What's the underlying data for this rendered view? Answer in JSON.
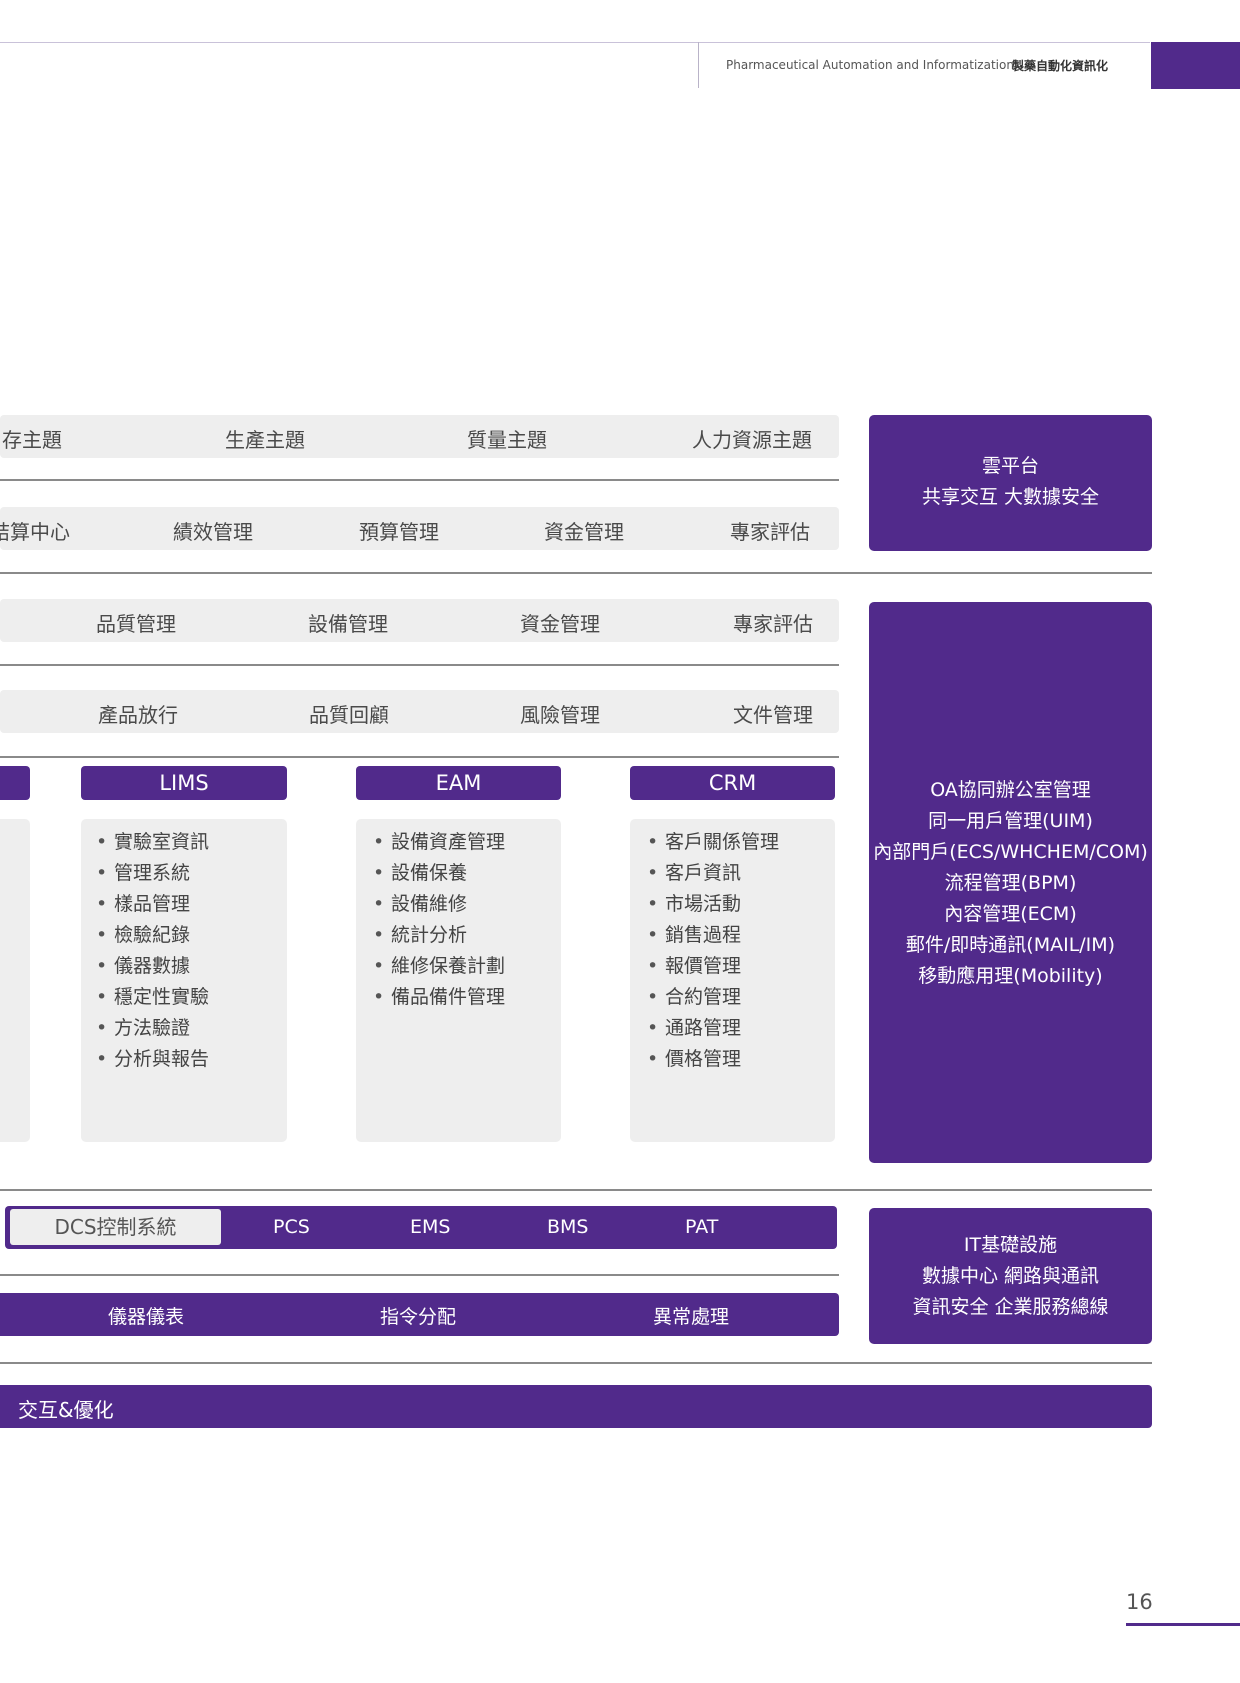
{
  "header": {
    "english": "Pharmaceutical Automation and Informatization",
    "chinese": "製藥自動化資訊化"
  },
  "themes": [
    "存主題",
    "生產主題",
    "質量主題",
    "人力資源主題"
  ],
  "management_row": [
    "結算中心",
    "績效管理",
    "預算管理",
    "資金管理",
    "專家評估"
  ],
  "quality_row": [
    "品質管理",
    "設備管理",
    "資金管理",
    "專家評估"
  ],
  "release_row": [
    "產品放行",
    "品質回顧",
    "風險管理",
    "文件管理"
  ],
  "cloud_panel": {
    "line1": "雲平台",
    "line2": "共享交互 大數據安全"
  },
  "systems": [
    {
      "title": "LIMS",
      "items": [
        "實驗室資訊",
        "管理系統",
        "樣品管理",
        "檢驗紀錄",
        "儀器數據",
        "穩定性實驗",
        "方法驗證",
        "分析與報告"
      ]
    },
    {
      "title": "EAM",
      "items": [
        "設備資產管理",
        "設備保養",
        "設備維修",
        "統計分析",
        "維修保養計劃",
        "備品備件管理"
      ]
    },
    {
      "title": "CRM",
      "items": [
        "客戶關係管理",
        "客戶資訊",
        "市場活動",
        "銷售過程",
        "報價管理",
        "合約管理",
        "通路管理",
        "價格管理"
      ]
    }
  ],
  "oa_panel": [
    "OA協同辦公室管理",
    "同一用戶管理(UIM)",
    "內部門戶(ECS/WHCHEM/COM)",
    "流程管理(BPM)",
    "內容管理(ECM)",
    "郵件/即時通訊(MAIL/IM)",
    "移動應用理(Mobility)"
  ],
  "control": {
    "dcs": "DCS控制系統",
    "pcs": "PCS",
    "ems": "EMS",
    "bms": "BMS",
    "pat": "PAT"
  },
  "bottom_row": [
    "儀器儀表",
    "指令分配",
    "異常處理"
  ],
  "it_panel": {
    "line1": "IT基礎設施",
    "line2": "數據中心 網路與通訊",
    "line3": "資訊安全 企業服務總線"
  },
  "interaction_bar": "交互&優化",
  "page_number": "16",
  "colors": {
    "accent": "#512a8b",
    "panel_grey": "#eeeeee",
    "rule": "#8a8a8a"
  }
}
